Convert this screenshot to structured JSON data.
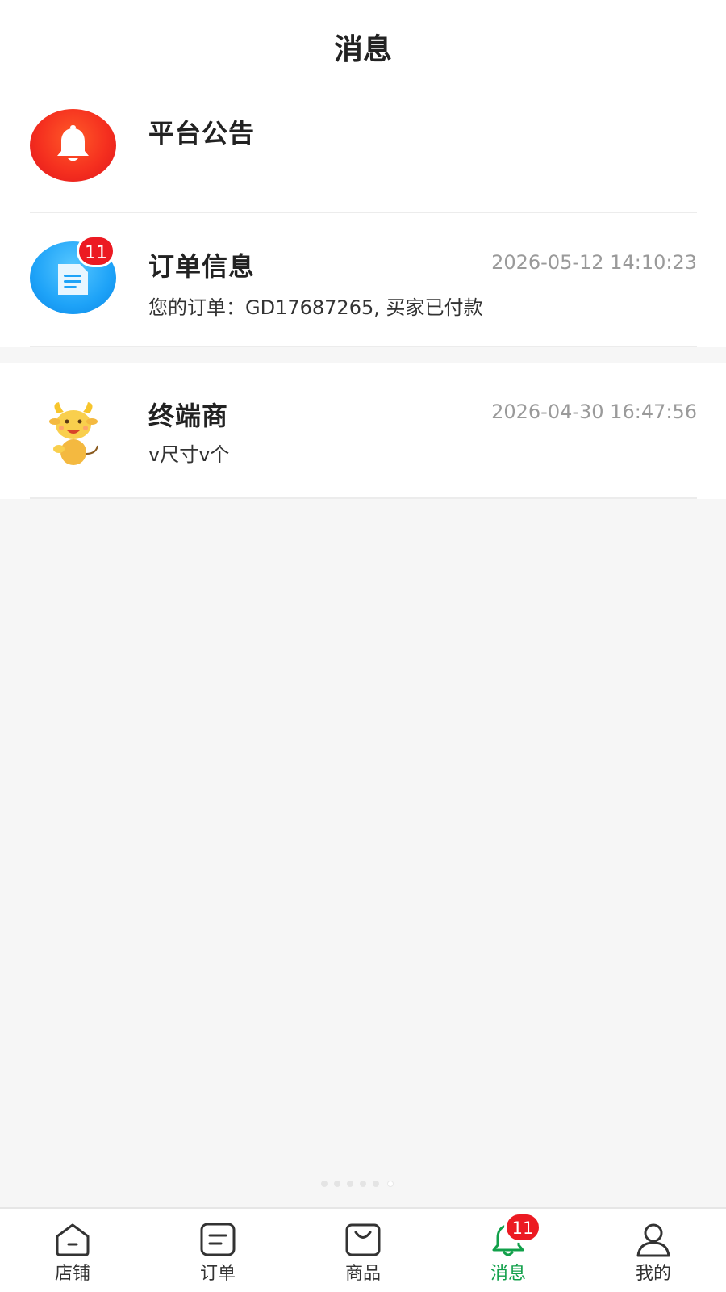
{
  "header": {
    "title": "消息"
  },
  "messages": [
    {
      "title": "平台公告",
      "icon": "bell-icon",
      "color": "#f5301f"
    },
    {
      "title": "订单信息",
      "time": "2026-05-12 14:10:23",
      "preview": "您的订单：GD17687265, 买家已付款",
      "badge": "11",
      "icon": "document-icon",
      "color": "#1ea3f8"
    },
    {
      "title": "终端商",
      "time": "2026-04-30 16:47:56",
      "preview": "v尺寸v个",
      "icon": "cow-mascot-icon"
    }
  ],
  "tabbar": {
    "items": [
      {
        "label": "店铺",
        "icon": "store-icon"
      },
      {
        "label": "订单",
        "icon": "order-icon"
      },
      {
        "label": "商品",
        "icon": "shopping-bag-icon"
      },
      {
        "label": "消息",
        "icon": "bell-icon",
        "active": true,
        "badge": "11"
      },
      {
        "label": "我的",
        "icon": "user-icon"
      }
    ],
    "active_color": "#11a04a"
  }
}
